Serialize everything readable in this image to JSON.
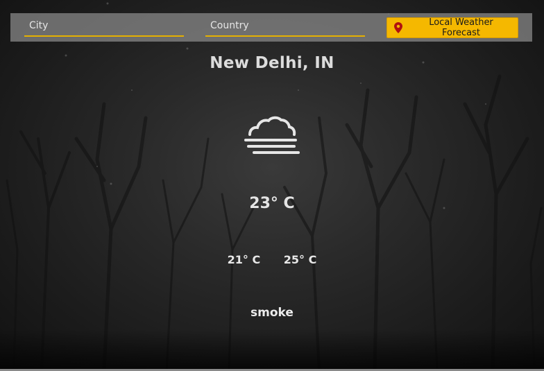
{
  "search": {
    "city_placeholder": "City",
    "country_placeholder": "Country",
    "button_label": "Local Weather Forecast",
    "button_icon": "map-pin-icon",
    "accent_color": "#f5b800"
  },
  "weather": {
    "location": "New Delhi, IN",
    "icon": "fog-icon",
    "temperature": "23° C",
    "temp_min": "21° C",
    "temp_max": "25° C",
    "description": "smoke"
  }
}
